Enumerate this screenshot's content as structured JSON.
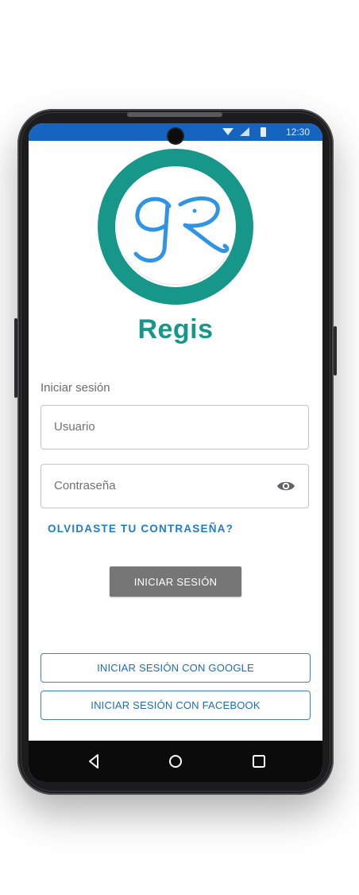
{
  "status_bar": {
    "time": "12:30",
    "wifi_icon": "wifi-icon",
    "signal_icon": "signal-icon",
    "battery_icon": "battery-icon"
  },
  "brand": {
    "name": "Regis",
    "logo_icon": "regis-logo",
    "logo_letters": "gR"
  },
  "login": {
    "section_label": "Iniciar sesión",
    "username_placeholder": "Usuario",
    "password_placeholder": "Contraseña",
    "visibility_icon": "eye-icon",
    "forgot_password": "OLVIDASTE TU CONTRASEÑA?",
    "submit_label": "INICIAR SESIÓN"
  },
  "social": {
    "google_label": "INICIAR SESIÓN CON GOOGLE",
    "facebook_label": "INICIAR SESIÓN CON FACEBOOK"
  },
  "nav_bar": {
    "back_icon": "back-icon",
    "home_icon": "home-icon",
    "recents_icon": "recents-icon"
  },
  "colors": {
    "status_bar": "#1565c0",
    "brand_teal": "#16978a",
    "logo_blue": "#2f94e4",
    "link_blue": "#1f7ad1",
    "button_gray": "#767676"
  }
}
